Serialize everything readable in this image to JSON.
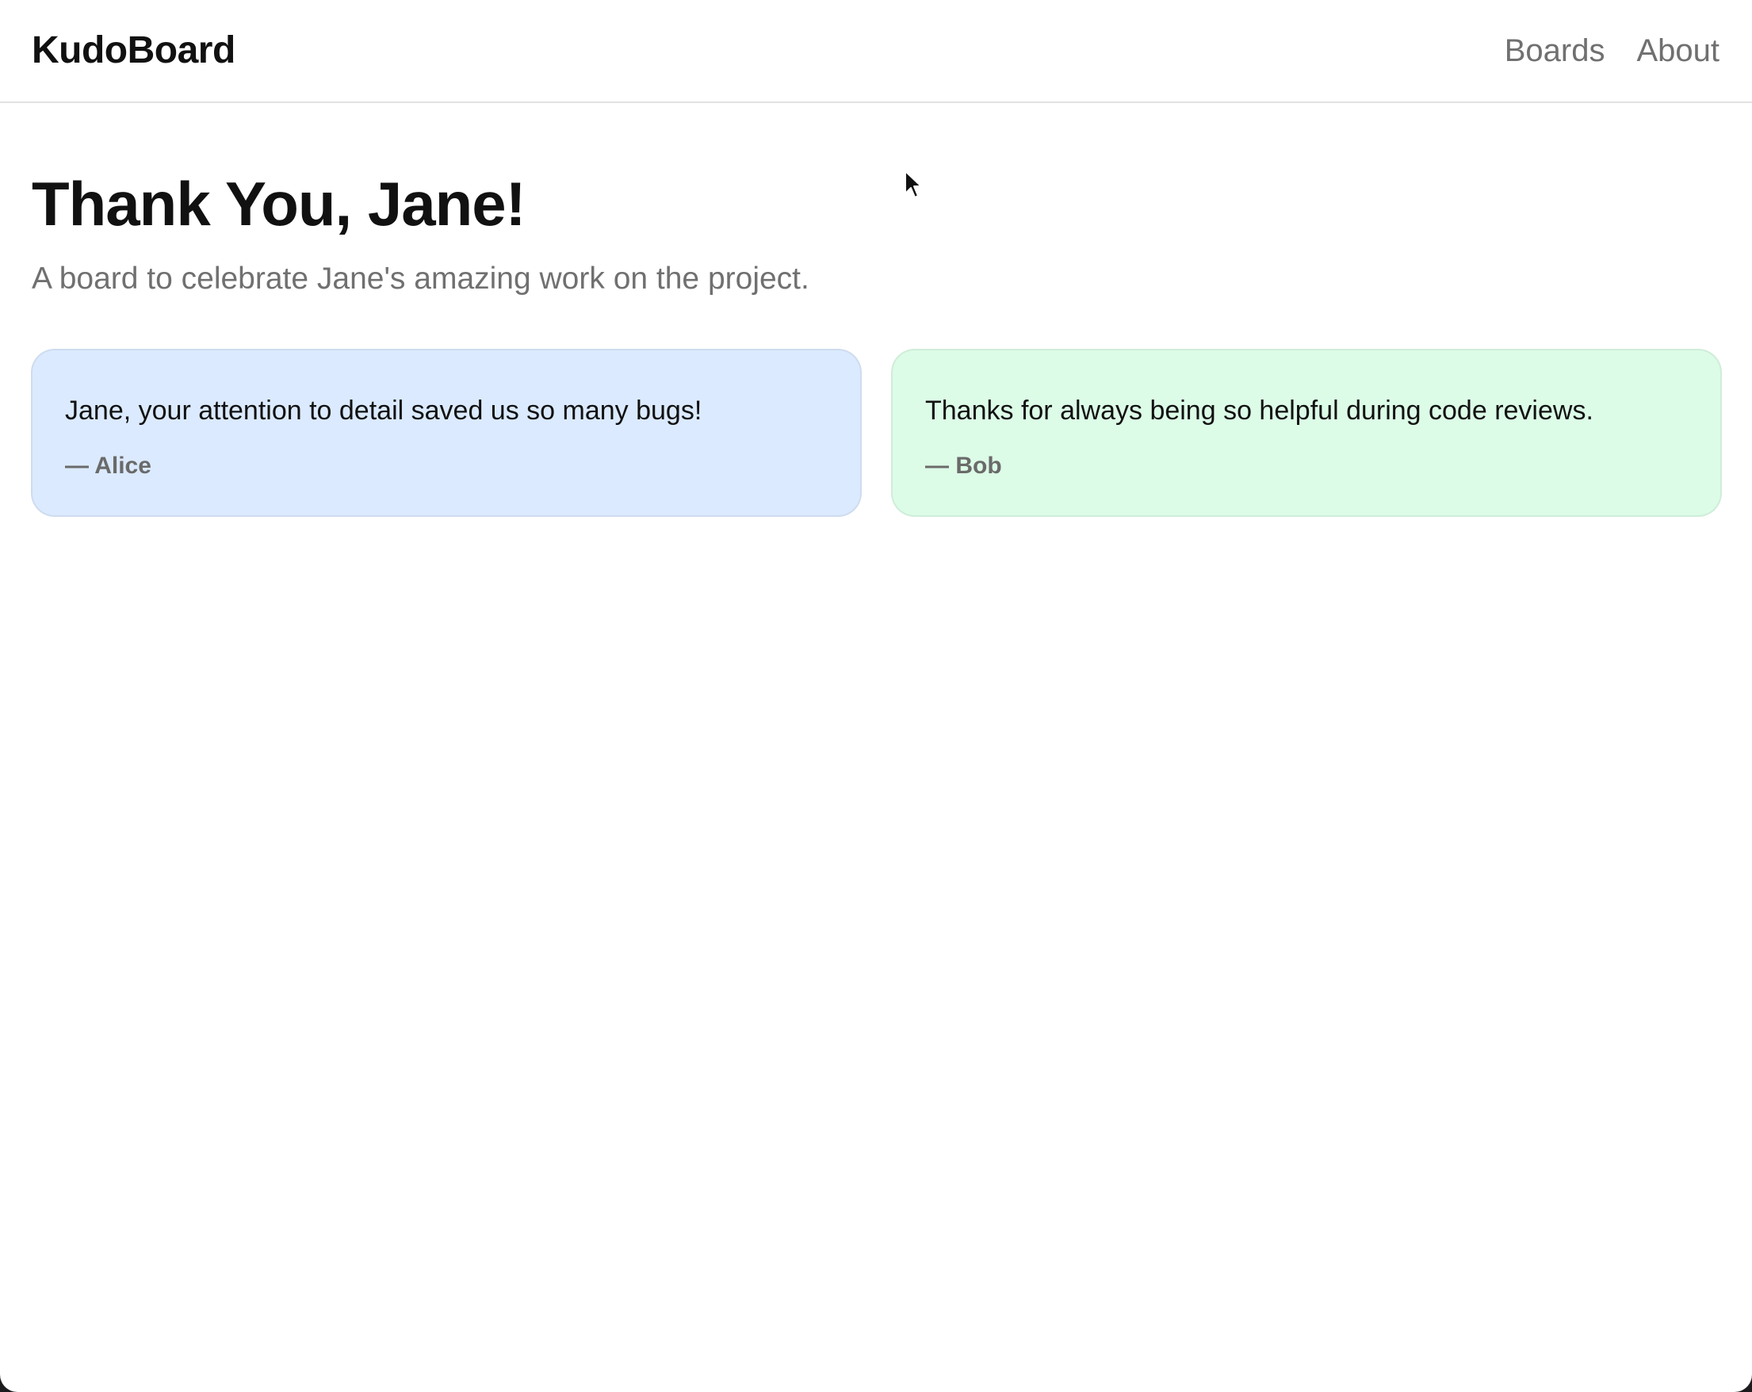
{
  "app": {
    "brand": "KudoBoard"
  },
  "nav": {
    "items": [
      {
        "label": "Boards"
      },
      {
        "label": "About"
      }
    ]
  },
  "board": {
    "title": "Thank You, Jane!",
    "subtitle": "A board to celebrate Jane's amazing work on the project."
  },
  "cards": [
    {
      "message": "Jane, your attention to detail saved us so many bugs!",
      "author": "— Alice",
      "color": "#dbeafe"
    },
    {
      "message": "Thanks for always being so helpful during code reviews.",
      "author": "— Bob",
      "color": "#dcfce7"
    }
  ],
  "colors": {
    "text_primary": "#111111",
    "text_muted": "#707070",
    "divider": "#e2e2e2"
  },
  "icons": {
    "cursor": "mouse-pointer-icon"
  }
}
